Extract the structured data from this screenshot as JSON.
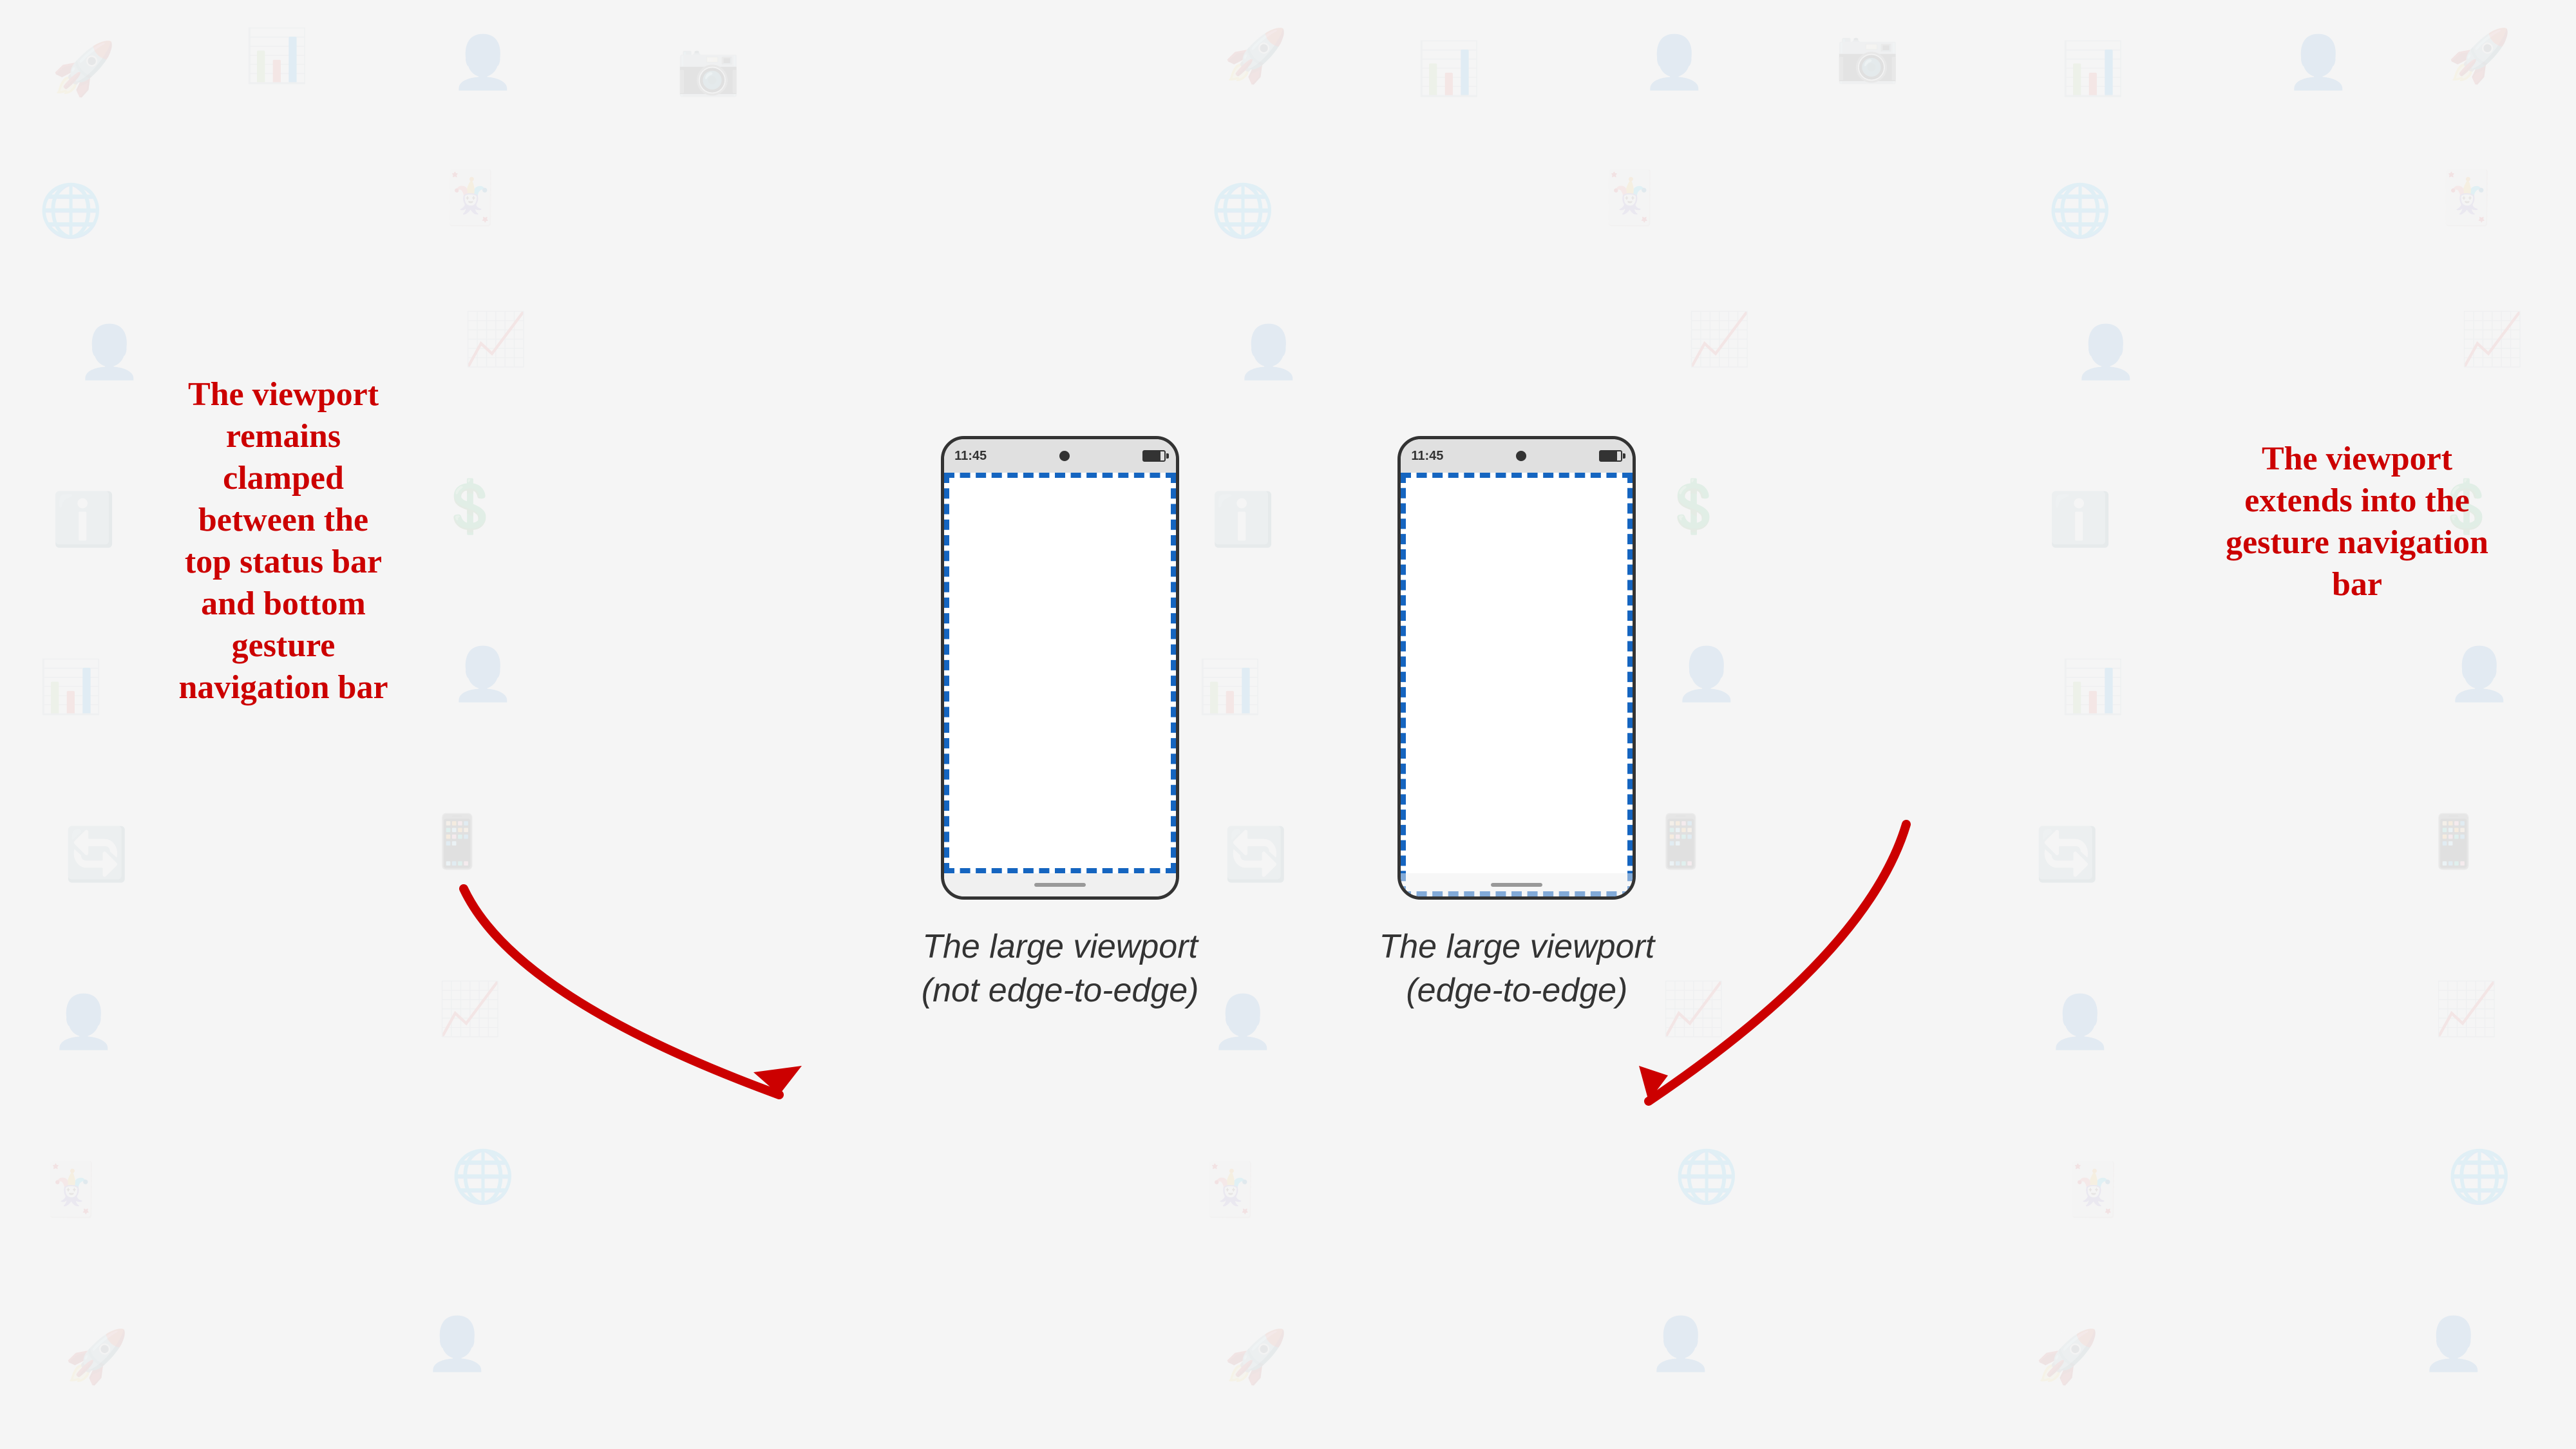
{
  "background": {
    "color": "#f5f5f5"
  },
  "phones": [
    {
      "id": "not-edge-to-edge",
      "status_bar": {
        "time": "11:45"
      },
      "caption_line1": "The large viewport",
      "caption_line2": "(not edge-to-edge)",
      "viewport_type": "clamped",
      "annotation": {
        "text": "The viewport\nremains\nclamped\nbetween the\ntop status bar\nand bottom\ngesture\nnavigation bar",
        "position": "left"
      }
    },
    {
      "id": "edge-to-edge",
      "status_bar": {
        "time": "11:45"
      },
      "caption_line1": "The large viewport",
      "caption_line2": "(edge-to-edge)",
      "viewport_type": "edge",
      "annotation": {
        "text": "The viewport\nextends into the\ngesture navigation\nbar",
        "position": "right"
      }
    }
  ],
  "annotations": {
    "left": "The viewport\nremains\nclamped\nbetween the\ntop status bar\nand bottom\ngesture\nnavigation bar",
    "right": "The viewport\nextends into the\ngesture navigation\nbar"
  }
}
